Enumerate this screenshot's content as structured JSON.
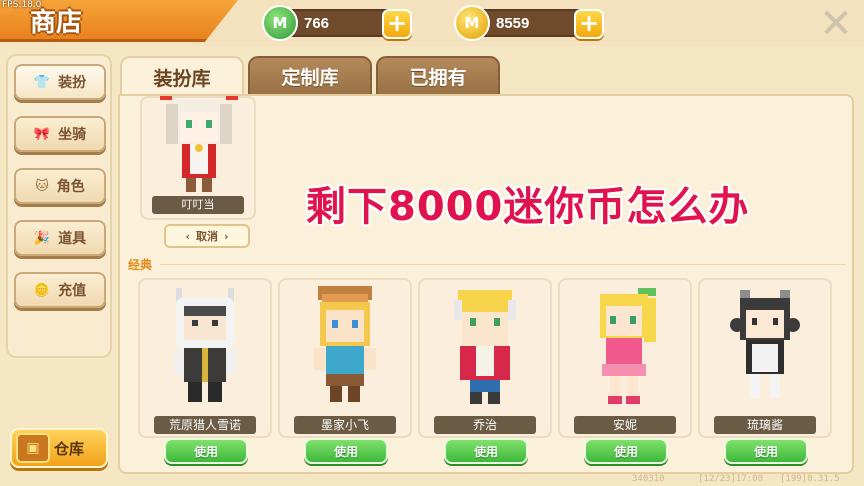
{
  "debug_label": "FPS:18.0",
  "title": "商店",
  "currencies": [
    {
      "icon": "green-gem-icon",
      "symbol": "M",
      "value": "766",
      "color": "#3cb44a"
    },
    {
      "icon": "gold-coin-icon",
      "symbol": "M",
      "value": "8559",
      "color": "#f0b400"
    }
  ],
  "sidebar": {
    "items": [
      {
        "label": "装扮",
        "icon": "shirt-icon"
      },
      {
        "label": "坐骑",
        "icon": "ribbon-icon"
      },
      {
        "label": "角色",
        "icon": "cat-face-icon"
      },
      {
        "label": "道具",
        "icon": "party-popper-icon"
      },
      {
        "label": "充值",
        "icon": "coin-stack-icon"
      }
    ],
    "warehouse_label": "仓库"
  },
  "tabs": [
    {
      "label": "装扮库",
      "active": true
    },
    {
      "label": "定制库",
      "active": false
    },
    {
      "label": "已拥有",
      "active": false
    }
  ],
  "selected": {
    "name": "叮叮当",
    "cancel_label": "取消"
  },
  "overlay_text": "剩下8000迷你币怎么办",
  "section_label": "经典",
  "characters": [
    {
      "name": "荒原猎人雪诺",
      "use_label": "使用"
    },
    {
      "name": "墨家小飞",
      "use_label": "使用"
    },
    {
      "name": "乔治",
      "use_label": "使用"
    },
    {
      "name": "安妮",
      "use_label": "使用"
    },
    {
      "name": "琉璃酱",
      "use_label": "使用"
    }
  ],
  "footer": [
    "340310",
    "[12/23]17:00",
    "[199]0.31.5"
  ]
}
